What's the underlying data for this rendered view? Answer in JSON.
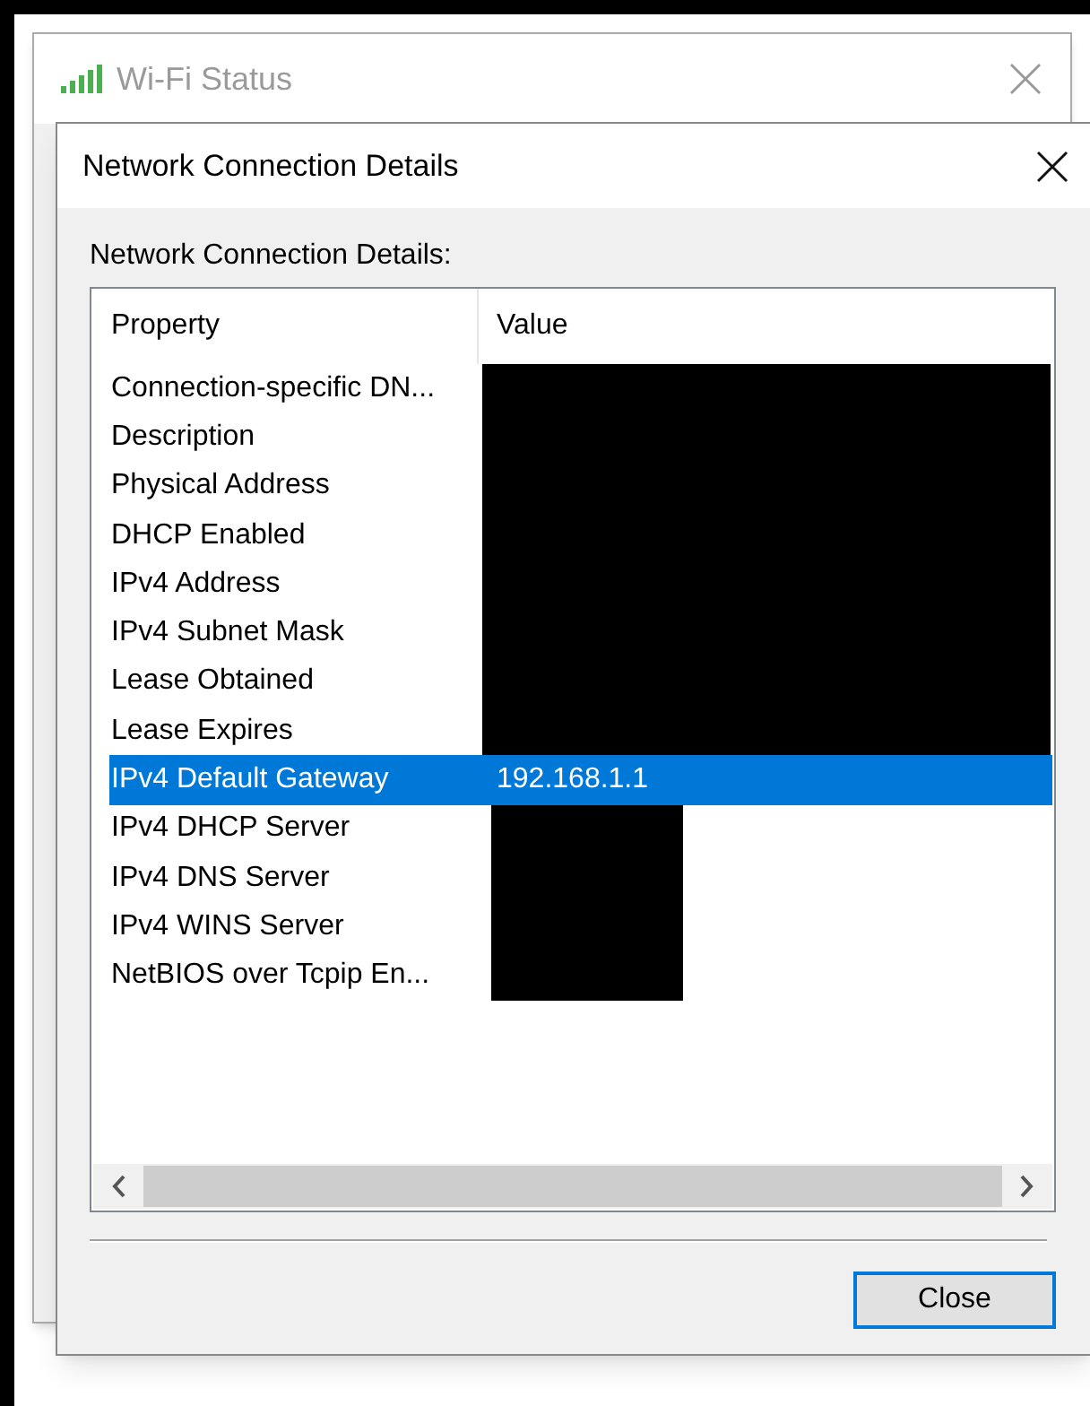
{
  "back_window": {
    "title": "Wi-Fi Status"
  },
  "dialog": {
    "title": "Network Connection Details",
    "label": "Network Connection Details:",
    "columns": [
      "Property",
      "Value"
    ],
    "rows": [
      {
        "kind": "wide",
        "property": "Connection-specific DN...",
        "selected": false
      },
      {
        "kind": "wide",
        "property": "Description",
        "selected": false
      },
      {
        "kind": "wide",
        "property": "Physical Address",
        "selected": false
      },
      {
        "kind": "wide",
        "property": "DHCP Enabled",
        "selected": false
      },
      {
        "kind": "wide",
        "property": "IPv4 Address",
        "selected": false
      },
      {
        "kind": "wide",
        "property": "IPv4 Subnet Mask",
        "selected": false
      },
      {
        "kind": "wide",
        "property": "Lease Obtained",
        "selected": false
      },
      {
        "kind": "wide",
        "property": "Lease Expires",
        "selected": false
      },
      {
        "kind": "shown",
        "property": "IPv4 Default Gateway",
        "value": "192.168.1.1",
        "selected": true
      },
      {
        "kind": "narrow",
        "property": "IPv4 DHCP Server",
        "selected": false
      },
      {
        "kind": "narrow",
        "property": "IPv4 DNS Server",
        "selected": false
      },
      {
        "kind": "narrow",
        "property": "IPv4 WINS Server",
        "selected": false
      },
      {
        "kind": "narrow",
        "property": "NetBIOS over Tcpip En...",
        "selected": false
      }
    ],
    "buttons": [
      "Close"
    ]
  }
}
